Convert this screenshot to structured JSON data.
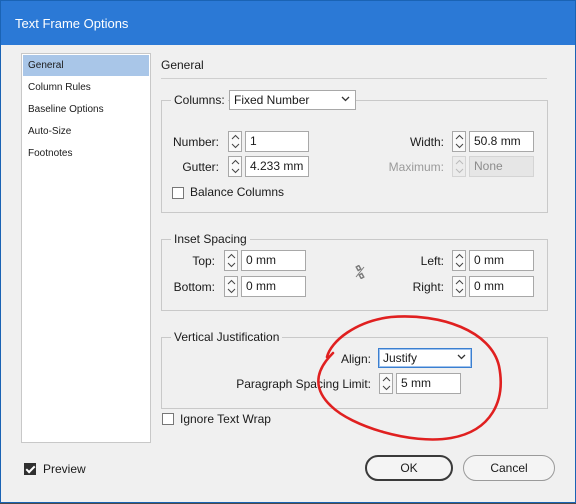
{
  "window": {
    "title": "Text Frame Options"
  },
  "sidebar": {
    "items": [
      {
        "label": "General",
        "selected": true
      },
      {
        "label": "Column Rules",
        "selected": false
      },
      {
        "label": "Baseline Options",
        "selected": false
      },
      {
        "label": "Auto-Size",
        "selected": false
      },
      {
        "label": "Footnotes",
        "selected": false
      }
    ]
  },
  "main": {
    "heading": "General",
    "columns": {
      "label": "Columns:",
      "selected": "Fixed Number",
      "number_label": "Number:",
      "number_value": "1",
      "gutter_label": "Gutter:",
      "gutter_value": "4.233 mm",
      "width_label": "Width:",
      "width_value": "50.8 mm",
      "maximum_label": "Maximum:",
      "maximum_value": "None",
      "balance_label": "Balance Columns",
      "balance_checked": false
    },
    "inset": {
      "legend": "Inset Spacing",
      "top_label": "Top:",
      "top_value": "0 mm",
      "bottom_label": "Bottom:",
      "bottom_value": "0 mm",
      "left_label": "Left:",
      "left_value": "0 mm",
      "right_label": "Right:",
      "right_value": "0 mm",
      "link_icon": "chain-link-broken-icon"
    },
    "vertical": {
      "legend": "Vertical Justification",
      "align_label": "Align:",
      "align_value": "Justify",
      "spacing_label": "Paragraph Spacing Limit:",
      "spacing_value": "5 mm"
    },
    "ignore_wrap": {
      "label": "Ignore Text Wrap",
      "checked": false
    }
  },
  "footer": {
    "preview_label": "Preview",
    "preview_checked": true,
    "ok_label": "OK",
    "cancel_label": "Cancel"
  },
  "colors": {
    "titlebar": "#2b79d6",
    "selection": "#a9c6e8",
    "annotation": "#e02020"
  }
}
